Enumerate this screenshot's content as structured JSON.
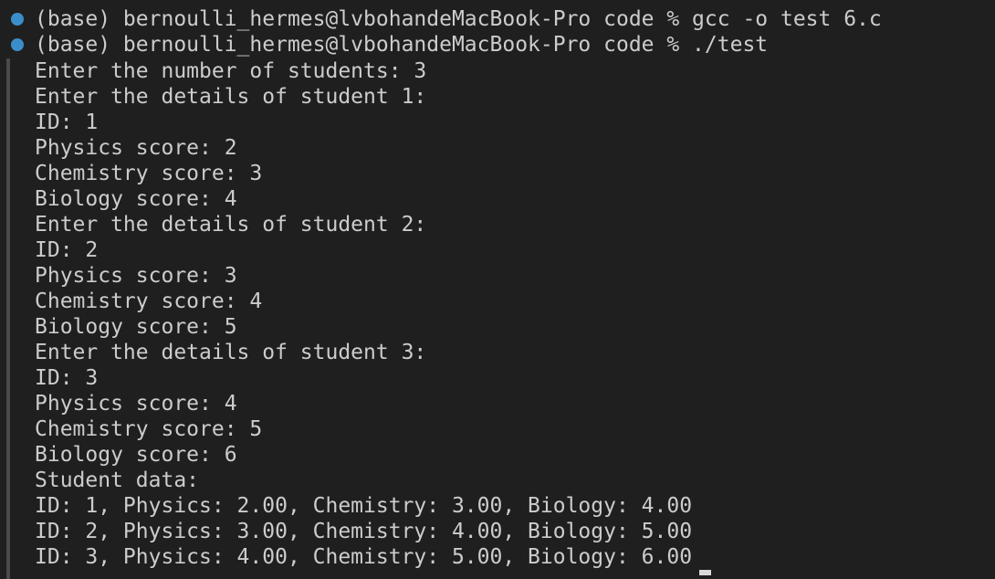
{
  "terminal": {
    "prompts": [
      {
        "text": "(base) bernoulli_hermes@lvbohandeMacBook-Pro code % gcc -o test 6.c"
      },
      {
        "text": "(base) bernoulli_hermes@lvbohandeMacBook-Pro code % ./test"
      }
    ],
    "output": [
      "Enter the number of students: 3",
      "Enter the details of student 1:",
      "ID: 1",
      "Physics score: 2",
      "Chemistry score: 3",
      "Biology score: 4",
      "Enter the details of student 2:",
      "ID: 2",
      "Physics score: 3",
      "Chemistry score: 4",
      "Biology score: 5",
      "Enter the details of student 3:",
      "ID: 3",
      "Physics score: 4",
      "Chemistry score: 5",
      "Biology score: 6",
      "Student data:",
      "ID: 1, Physics: 2.00, Chemistry: 3.00, Biology: 4.00",
      "ID: 2, Physics: 3.00, Chemistry: 4.00, Biology: 5.00",
      "ID: 3, Physics: 4.00, Chemistry: 5.00, Biology: 6.00"
    ]
  },
  "colors": {
    "background": "#1f1f1f",
    "text": "#cccccc",
    "prompt_dot": "#3b8ec9"
  }
}
